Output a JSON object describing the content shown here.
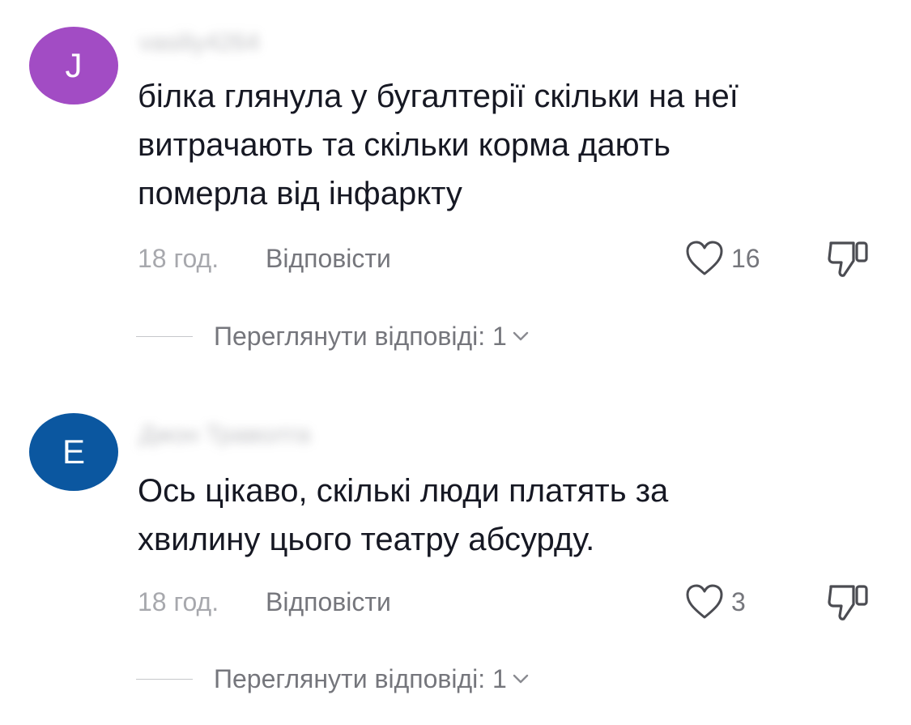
{
  "comments": [
    {
      "avatar_letter": "J",
      "avatar_color": "#a24cc4",
      "username": "vasiliy4264",
      "text_lines": [
        "білка глянула у бугалтерії скільки на неї",
        "витрачають та скільки корма дають",
        "померла від інфаркту"
      ],
      "time": "18 год.",
      "reply_label": "Відповісти",
      "likes": "16",
      "view_replies": "Переглянути відповіді: 1"
    },
    {
      "avatar_letter": "E",
      "avatar_color": "#0b57a0",
      "username": "Джон Траволта",
      "text_lines": [
        "Ось цікаво, скількі люди платять за",
        "хвилину цього театру абсурду."
      ],
      "time": "18 год.",
      "reply_label": "Відповісти",
      "likes": "3",
      "view_replies": "Переглянути відповіді: 1"
    }
  ],
  "icons": {
    "like": "heart-outline-icon",
    "dislike": "thumbs-down-outline-icon",
    "expand": "chevron-down-icon"
  }
}
